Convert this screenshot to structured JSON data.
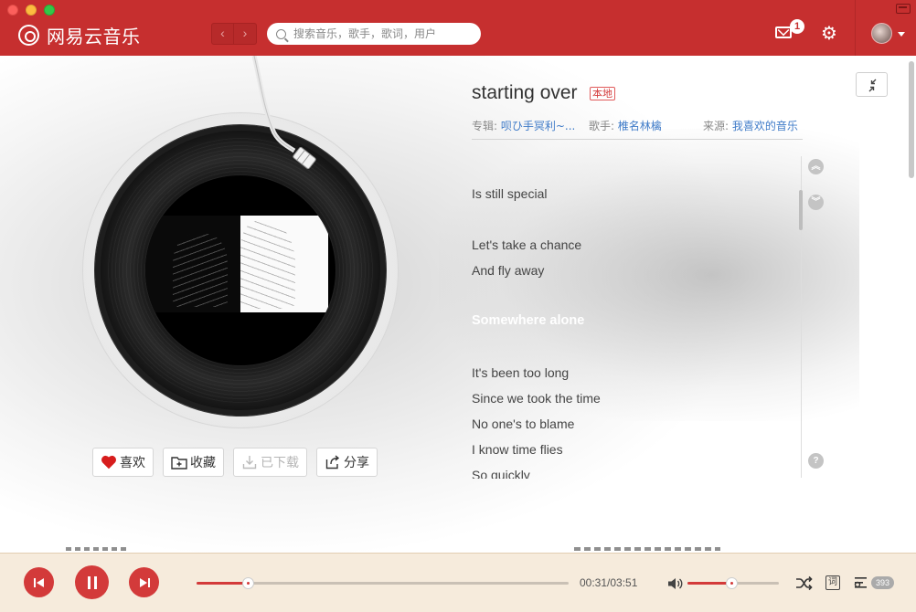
{
  "app": {
    "name": "网易云音乐",
    "brand_color": "#c62f2f",
    "accent_color": "#d33a3a"
  },
  "titlebar": {
    "back_icon": "‹",
    "forward_icon": "›",
    "search_placeholder": "搜索音乐，歌手，歌词，用户",
    "mail_badge": "1",
    "gear_icon": "⚙"
  },
  "song": {
    "title": "starting over",
    "local_tag": "本地",
    "album_label": "专辑:",
    "album_value": "呗ひ手冥利~...",
    "singer_label": "歌手:",
    "singer_value": "椎名林檎",
    "source_label": "来源:",
    "source_value": "我喜欢的音乐"
  },
  "actions": {
    "like": "喜欢",
    "collect": "收藏",
    "download": "已下载",
    "share": "分享"
  },
  "lyrics": {
    "lines": [
      {
        "text": "Is still special",
        "current": false
      },
      {
        "text": "",
        "current": false
      },
      {
        "text": "Let's take a chance",
        "current": false
      },
      {
        "text": "And fly away",
        "current": false
      },
      {
        "text": "",
        "current": false
      },
      {
        "text": "Somewhere alone",
        "current": true
      },
      {
        "text": "",
        "current": false
      },
      {
        "text": "It's been too long",
        "current": false
      },
      {
        "text": "Since we took the time",
        "current": false
      },
      {
        "text": "No one's to blame",
        "current": false
      },
      {
        "text": "I know time flies",
        "current": false
      },
      {
        "text": "So quickly",
        "current": false
      }
    ],
    "up_icon": "︽",
    "down_icon": "︾",
    "help_icon": "?"
  },
  "player": {
    "current_time": "00:31",
    "total_time": "03:51",
    "progress_fraction": 0.137,
    "volume_fraction": 0.48,
    "lyric_toggle": "词",
    "playlist_count": "393"
  }
}
